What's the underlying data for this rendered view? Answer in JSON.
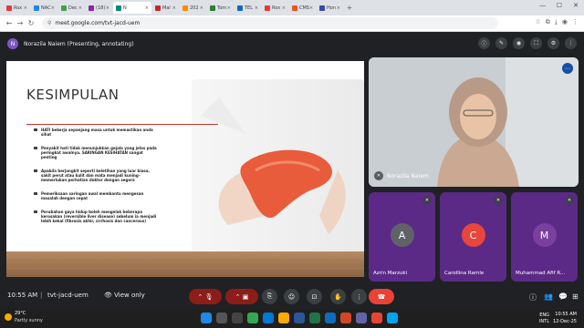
{
  "browser": {
    "tabs": [
      {
        "label": "Rox",
        "color": "#e53935"
      },
      {
        "label": "NAC",
        "color": "#1e88e5"
      },
      {
        "label": "Dec",
        "color": "#43a047"
      },
      {
        "label": "(18)",
        "color": "#8e24aa"
      },
      {
        "label": "N",
        "color": "#00897b",
        "active": true
      },
      {
        "label": "Mai",
        "color": "#c62828"
      },
      {
        "label": "202",
        "color": "#fb8c00"
      },
      {
        "label": "Tom",
        "color": "#2e7d32"
      },
      {
        "label": "TEL",
        "color": "#1565c0"
      },
      {
        "label": "Rox",
        "color": "#e53935"
      },
      {
        "label": "CMS",
        "color": "#f4511e"
      },
      {
        "label": "Hon",
        "color": "#3949ab"
      }
    ],
    "url": "meet.google.com/tvt-jacd-uem"
  },
  "meet": {
    "presenter_initial": "N",
    "presenter_label": "Norazila Naiem (Presenting, annotating)",
    "slide": {
      "title": "KESIMPULAN",
      "bullets": [
        "HATI bekerja sepanjang masa untuk memastikan anda sihat",
        "Penyakit hati tidak menunjukkan gejala yang jelas pada peringkat awalnya. SARINGAN KESIHATAN sangat penting",
        "Apabila berjangkit seperti keletihan yang luar biasa, sakit perut atau kulit dan mata menjadi kuning- memerlukan perhatian doktor dengan segera",
        "Pemeriksaan saringan awal membantu mengesan masalah dengan cepat",
        "Perubahan gaya hidup boleh mengelak beberapa kerosakan (reversible liver disease) sebelum ia menjadi lebih kekal (fibrosis akhir, cirrhosis dan cancerous)"
      ]
    },
    "main_participant": "Norazila Naiem",
    "participants": [
      {
        "initial": "A",
        "name": "Azrin Marzuki",
        "color": "#5f6368"
      },
      {
        "initial": "C",
        "name": "Carollina Ramle",
        "color": "#e8453c"
      },
      {
        "initial": "M",
        "name": "Muhammad Afif R...",
        "color": "#7b3fa0"
      }
    ],
    "time": "10:55 AM",
    "separator": "|",
    "meeting_code": "tvt-jacd-uem",
    "view_only": "View only"
  },
  "taskbar": {
    "temp": "29°C",
    "weather": "Partly sunny",
    "lang": "ENG",
    "lang2": "INTL",
    "clock": "10:55 AM",
    "date": "12-Dec-25"
  }
}
